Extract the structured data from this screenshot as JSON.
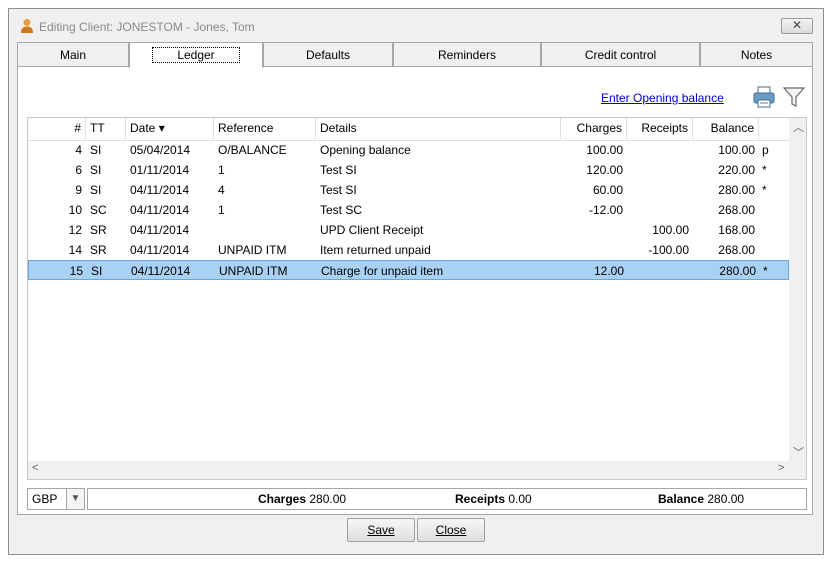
{
  "window": {
    "title": "Editing Client: JONESTOM - Jones, Tom",
    "close_label": "✕"
  },
  "tabs": [
    {
      "label": "Main"
    },
    {
      "label": "Ledger"
    },
    {
      "label": "Defaults"
    },
    {
      "label": "Reminders"
    },
    {
      "label": "Credit control"
    },
    {
      "label": "Notes"
    }
  ],
  "toolbar": {
    "opening_link": "Enter Opening balance",
    "printer_icon": "printer-icon",
    "filter_icon": "filter-icon"
  },
  "ledger": {
    "columns": [
      "#",
      "TT",
      "Date",
      "Reference",
      "Details",
      "Charges",
      "Receipts",
      "Balance"
    ],
    "sort_indicator": "▾",
    "rows": [
      {
        "num": "4",
        "tt": "SI",
        "date": "05/04/2014",
        "ref": "O/BALANCE",
        "details": "Opening balance",
        "charges": "100.00",
        "receipts": "",
        "balance": "100.00",
        "flag": "p"
      },
      {
        "num": "6",
        "tt": "SI",
        "date": "01/11/2014",
        "ref": "1",
        "details": "Test SI",
        "charges": "120.00",
        "receipts": "",
        "balance": "220.00",
        "flag": "*"
      },
      {
        "num": "9",
        "tt": "SI",
        "date": "04/11/2014",
        "ref": "4",
        "details": "Test SI",
        "charges": "60.00",
        "receipts": "",
        "balance": "280.00",
        "flag": "*"
      },
      {
        "num": "10",
        "tt": "SC",
        "date": "04/11/2014",
        "ref": "1",
        "details": "Test SC",
        "charges": "-12.00",
        "receipts": "",
        "balance": "268.00",
        "flag": ""
      },
      {
        "num": "12",
        "tt": "SR",
        "date": "04/11/2014",
        "ref": "",
        "details": "UPD Client Receipt",
        "charges": "",
        "receipts": "100.00",
        "balance": "168.00",
        "flag": ""
      },
      {
        "num": "14",
        "tt": "SR",
        "date": "04/11/2014",
        "ref": "UNPAID ITM",
        "details": "Item returned unpaid",
        "charges": "",
        "receipts": "-100.00",
        "balance": "268.00",
        "flag": ""
      },
      {
        "num": "15",
        "tt": "SI",
        "date": "04/11/2014",
        "ref": "UNPAID ITM",
        "details": "Charge for unpaid item",
        "charges": "12.00",
        "receipts": "",
        "balance": "280.00",
        "flag": "*"
      }
    ],
    "selected_index": 6
  },
  "footer": {
    "currency": "GBP",
    "charges_label": "Charges",
    "charges_value": "280.00",
    "receipts_label": "Receipts",
    "receipts_value": "0.00",
    "balance_label": "Balance",
    "balance_value": "280.00"
  },
  "buttons": {
    "save_label": "Save",
    "close_label": "Close"
  },
  "colors": {
    "selected_row": "#a9d1f4",
    "link": "#0000cc"
  }
}
